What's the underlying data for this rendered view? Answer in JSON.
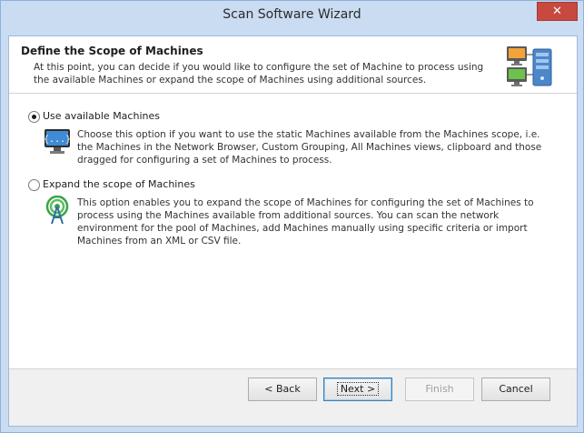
{
  "window": {
    "title": "Scan Software Wizard",
    "close_glyph": "✕"
  },
  "header": {
    "title": "Define the Scope of Machines",
    "description": "At this point, you can decide if you would like to configure the set of Machine to process using the available Machines or expand the scope of Machines using additional sources.",
    "icon": "computers-server-icon"
  },
  "options": [
    {
      "label": "Use available Machines",
      "selected": true,
      "icon": "code-monitor-icon",
      "description": "Choose this option if you want to use the static Machines available from the Machines scope, i.e. the Machines in the Network Browser, Custom Grouping, All Machines views, clipboard and those dragged for configuring a set of Machines to process."
    },
    {
      "label": "Expand the scope of Machines",
      "selected": false,
      "icon": "antenna-broadcast-icon",
      "description": "This option enables you to expand the scope of Machines for configuring the set of Machines to process using the Machines available from additional sources. You can scan the network environment for the pool of Machines, add Machines manually using specific criteria or import Machines from an XML or CSV file."
    }
  ],
  "buttons": {
    "back": "< Back",
    "next": "Next >",
    "finish": "Finish",
    "cancel": "Cancel"
  },
  "colors": {
    "title_bar": "#c9dcf2",
    "close_button": "#c7493f",
    "footer": "#f0f0f0"
  }
}
